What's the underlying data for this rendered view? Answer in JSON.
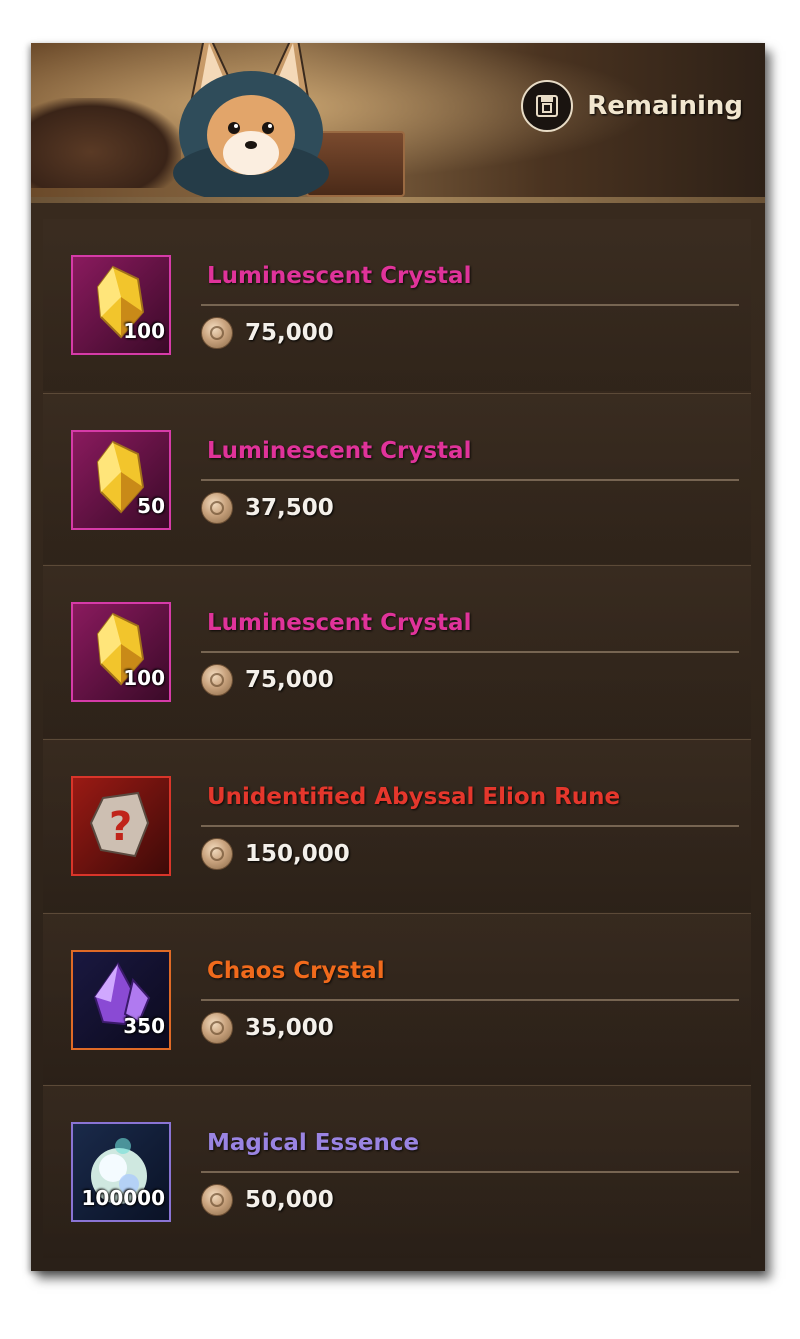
{
  "header": {
    "remaining_label": "Remaining",
    "remaining_icon": "chest-box-icon"
  },
  "items": [
    {
      "name": "Luminescent Crystal",
      "quantity": "100",
      "price": "75,000",
      "name_color": "#e0339a",
      "icon": "luminescent-crystal-icon",
      "frame_color": "#d63ba8"
    },
    {
      "name": "Luminescent Crystal",
      "quantity": "50",
      "price": "37,500",
      "name_color": "#e0339a",
      "icon": "luminescent-crystal-icon",
      "frame_color": "#d63ba8"
    },
    {
      "name": "Luminescent Crystal",
      "quantity": "100",
      "price": "75,000",
      "name_color": "#e0339a",
      "icon": "luminescent-crystal-icon",
      "frame_color": "#d63ba8"
    },
    {
      "name": "Unidentified Abyssal Elion Rune",
      "quantity": "",
      "price": "150,000",
      "name_color": "#e5372c",
      "icon": "abyssal-rune-icon",
      "frame_color": "#d9352a"
    },
    {
      "name": "Chaos Crystal",
      "quantity": "350",
      "price": "35,000",
      "name_color": "#f06a1c",
      "icon": "chaos-crystal-icon",
      "frame_color": "#e06a26"
    },
    {
      "name": "Magical Essence",
      "quantity": "100000",
      "price": "50,000",
      "name_color": "#9a84e2",
      "icon": "magical-essence-orb-icon",
      "frame_color": "#8a74d4"
    }
  ],
  "currency_icon": "coin-icon"
}
